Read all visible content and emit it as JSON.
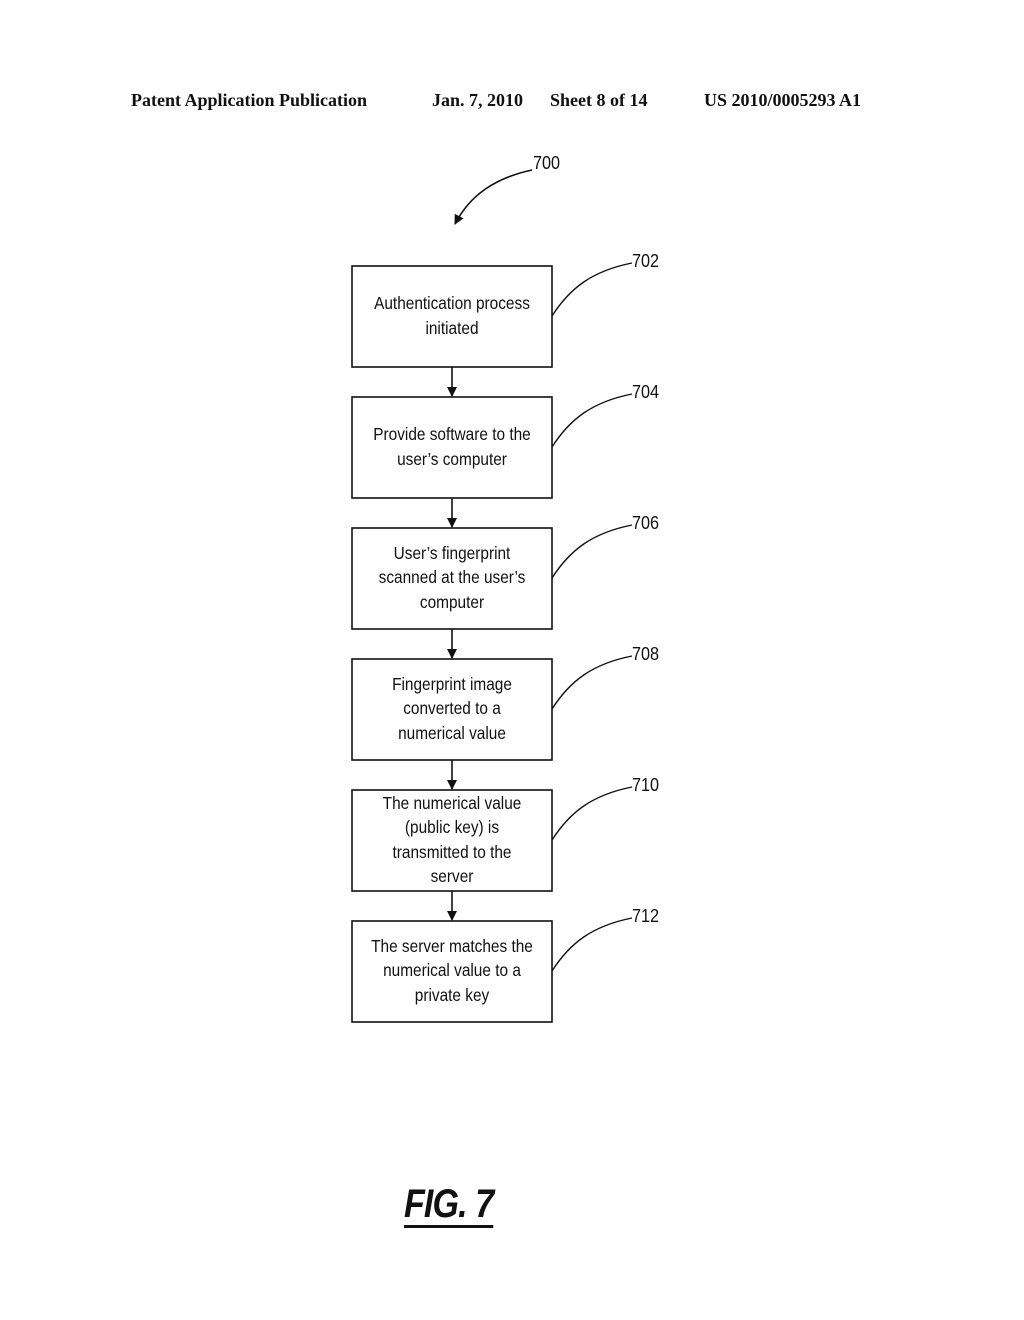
{
  "header": {
    "publication": "Patent Application Publication",
    "date": "Jan. 7, 2010",
    "sheet": "Sheet 8 of 14",
    "number": "US 2010/0005293 A1"
  },
  "figure": {
    "ref": "700",
    "label": "FIG. 7"
  },
  "steps": [
    {
      "ref": "702",
      "lines": [
        "Authentication process",
        "initiated"
      ]
    },
    {
      "ref": "704",
      "lines": [
        "Provide software to the",
        "user’s computer"
      ]
    },
    {
      "ref": "706",
      "lines": [
        "User’s fingerprint",
        "scanned at the user’s",
        "computer"
      ]
    },
    {
      "ref": "708",
      "lines": [
        "Fingerprint image",
        "converted to a",
        "numerical value"
      ]
    },
    {
      "ref": "710",
      "lines": [
        "The numerical value",
        "(public key) is",
        "transmitted to the",
        "server"
      ]
    },
    {
      "ref": "712",
      "lines": [
        "The server matches the",
        "numerical value to a",
        "private key"
      ]
    }
  ]
}
